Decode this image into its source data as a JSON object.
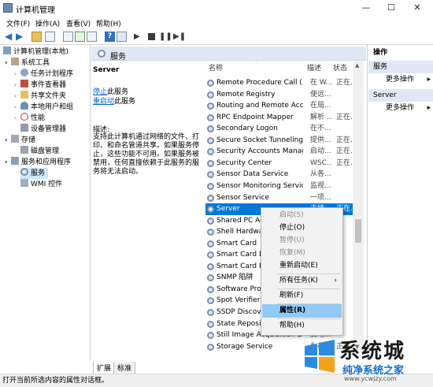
{
  "window": {
    "title": "计算机管理",
    "min": "—",
    "max": "☐",
    "close": "✕"
  },
  "menu": [
    "文件(F)",
    "操作(A)",
    "查看(V)",
    "帮助(H)"
  ],
  "tree": {
    "root": "计算机管理(本地)",
    "system_tools": "系统工具",
    "task_scheduler": "任务计划程序",
    "event_viewer": "事件查看器",
    "shared_folders": "共享文件夹",
    "local_users": "本地用户和组",
    "performance": "性能",
    "device_manager": "设备管理器",
    "storage": "存储",
    "disk_management": "磁盘管理",
    "services_apps": "服务和应用程序",
    "services": "服务",
    "wmi": "WMI 控件"
  },
  "center": {
    "header": "服务",
    "selected_name": "Server",
    "stop_link": "停止",
    "stop_rest": "此服务",
    "restart_link": "重启动",
    "restart_rest": "此服务",
    "desc_label": "描述:",
    "desc_text": "支持此计算机通过网络的文件、打印、和命名管道共享。如果服务停止，这些功能不可用。如果服务被禁用，任何直接依赖于此服务的服务将无法启动。"
  },
  "columns": {
    "name": "名称",
    "desc": "描述",
    "status": "状态"
  },
  "services": [
    {
      "name": "Remote Procedure Call (...",
      "desc": "在 W...",
      "status": "正在..."
    },
    {
      "name": "Remote Registry",
      "desc": "使远...",
      "status": ""
    },
    {
      "name": "Routing and Remote Acc...",
      "desc": "在局...",
      "status": ""
    },
    {
      "name": "RPC Endpoint Mapper",
      "desc": "解析 ...",
      "status": "正在..."
    },
    {
      "name": "Secondary Logon",
      "desc": "在不...",
      "status": ""
    },
    {
      "name": "Secure Socket Tunneling ...",
      "desc": "提供...",
      "status": "正在..."
    },
    {
      "name": "Security Accounts Manag...",
      "desc": "启动...",
      "status": "正在..."
    },
    {
      "name": "Security Center",
      "desc": "WSC...",
      "status": "正在..."
    },
    {
      "name": "Sensor Data Service",
      "desc": "从各...",
      "status": ""
    },
    {
      "name": "Sensor Monitoring Service",
      "desc": "监视...",
      "status": ""
    },
    {
      "name": "Sensor Service",
      "desc": "一项...",
      "status": ""
    },
    {
      "name": "Server",
      "desc": "支持...",
      "status": "正在..."
    },
    {
      "name": "Shared PC Ac...",
      "desc": "",
      "status": ""
    },
    {
      "name": "Shell Hardwa...",
      "desc": "",
      "status": ""
    },
    {
      "name": "Smart Card",
      "desc": "",
      "status": ""
    },
    {
      "name": "Smart Card D...",
      "desc": "",
      "status": ""
    },
    {
      "name": "Smart Card R...",
      "desc": "",
      "status": ""
    },
    {
      "name": "SNMP 陷阱",
      "desc": "",
      "status": ""
    },
    {
      "name": "Software Prot...",
      "desc": "",
      "status": ""
    },
    {
      "name": "Spot Verifier",
      "desc": "",
      "status": ""
    },
    {
      "name": "SSDP Discove...",
      "desc": "",
      "status": ""
    },
    {
      "name": "State Reposit...",
      "desc": "",
      "status": ""
    },
    {
      "name": "Still Image Acquisition Ev...",
      "desc": "启动...",
      "status": ""
    },
    {
      "name": "Storage Service",
      "desc": "为存...",
      "status": "正在..."
    }
  ],
  "context_menu": {
    "start": "启动(S)",
    "stop": "停止(O)",
    "pause": "暂停(U)",
    "resume": "恢复(M)",
    "restart": "重新启动(E)",
    "all_tasks": "所有任务(K)",
    "refresh": "刷新(F)",
    "properties": "属性(R)",
    "help": "帮助(H)"
  },
  "actions": {
    "title": "操作",
    "section1": "服务",
    "more1": "更多操作",
    "section2": "Server",
    "more2": "更多操作"
  },
  "tabs": {
    "extended": "扩展",
    "standard": "标准"
  },
  "status": "打开当前所选内容的属性对话框。",
  "watermark": {
    "big": "系统城",
    "small": "纯净系统之家",
    "url": "www.ycwjzy.com"
  },
  "colors": {
    "accent": "#cde8ff",
    "selected": "#0078d7",
    "header_bg": "#dfe9f5",
    "ctx_hover": "#91c9f7"
  }
}
